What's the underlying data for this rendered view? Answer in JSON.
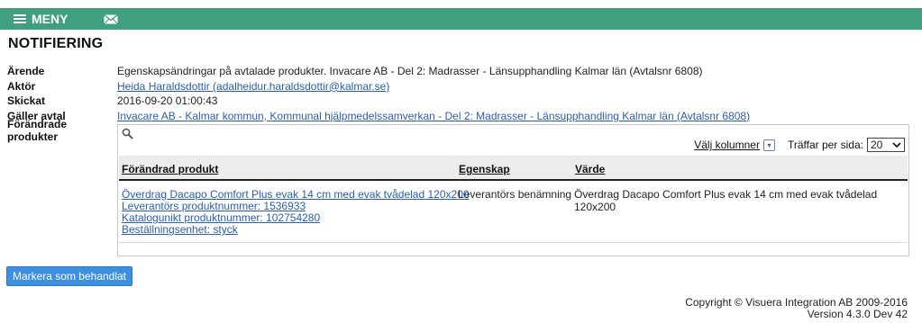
{
  "topbar": {
    "menu_label": "MENY",
    "icons": [
      "hamburger-icon",
      "mail-icon"
    ],
    "color": "#3f9f7f"
  },
  "page_title": "NOTIFIERING",
  "details": {
    "arende_label": "Ärende",
    "arende_value": "Egenskapsändringar på avtalade produkter. Invacare AB - Del 2: Madrasser - Länsupphandling Kalmar län (Avtalsnr 6808)",
    "aktor_label": "Aktör",
    "aktor_value": "Heida Haraldsdottir (adalheidur.haraldsdottir@kalmar.se)",
    "skickat_label": "Skickat",
    "skickat_value": "2016-09-20 01:00:43",
    "galler_label": "Gäller avtal",
    "galler_value": "Invacare AB - Kalmar kommun, Kommunal hjälpmedelssamverkan - Del 2: Madrasser - Länsupphandling Kalmar län (Avtalsnr 6808)",
    "forandrade_label": "Förändrade produkter"
  },
  "table": {
    "choose_columns": "Välj kolumner",
    "hits_per_page_label": "Träffar per sida:",
    "hits_per_page_value": "20",
    "headers": [
      "Förändrad produkt",
      "Egenskap",
      "Värde"
    ],
    "rows": [
      {
        "product_lines": [
          "Överdrag Dacapo Comfort Plus evak 14 cm med evak tvådelad 120x200",
          "Leverantörs produktnummer: 1536933",
          "Katalogunikt produktnummer: 102754280",
          "Beställningsenhet: styck"
        ],
        "property": "Leverantörs benämning",
        "value": "Överdrag Dacapo Comfort Plus evak 14 cm med evak tvådelad 120x200"
      }
    ]
  },
  "mark_button": "Markera som behandlat",
  "footer": {
    "copyright": "Copyright © Visuera Integration AB 2009-2016",
    "version": "Version 4.3.0 Dev 42"
  }
}
